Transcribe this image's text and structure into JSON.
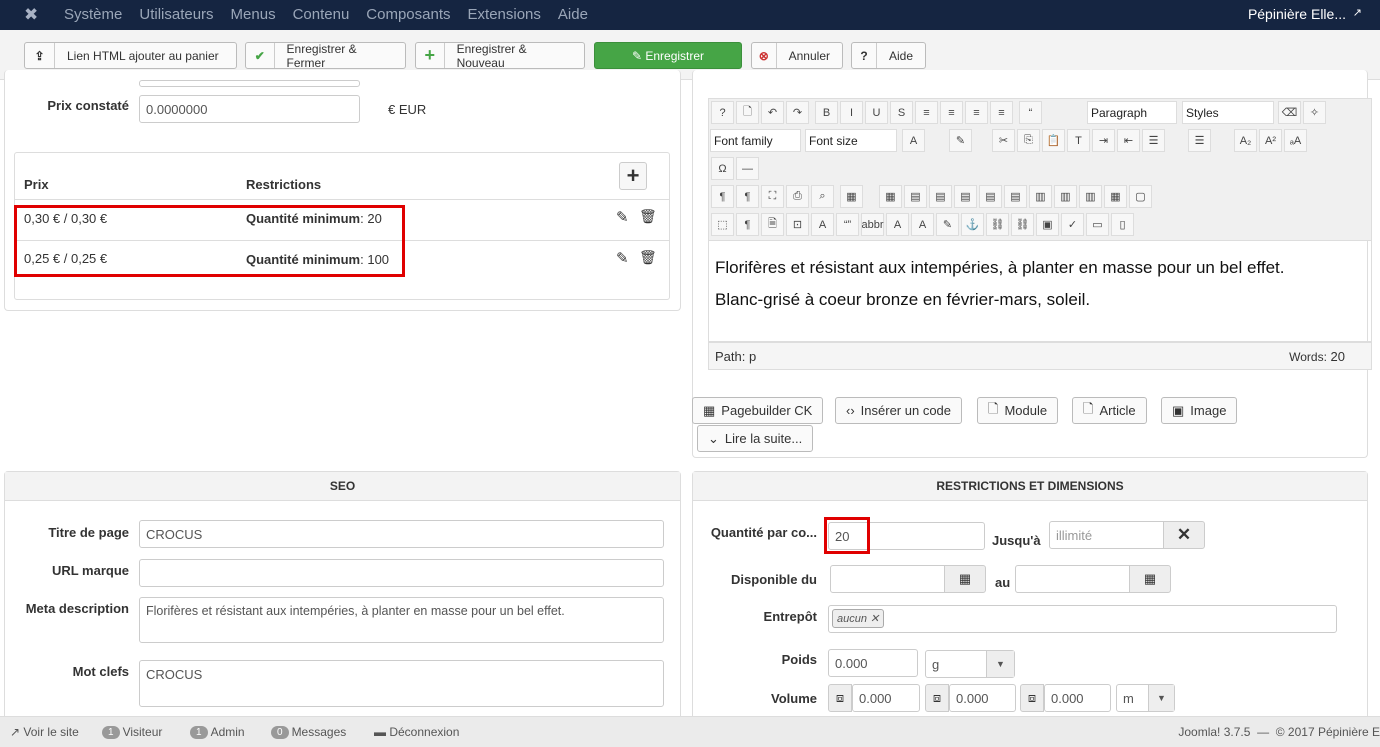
{
  "nav": {
    "items": [
      "Système",
      "Utilisateurs",
      "Menus",
      "Contenu",
      "Composants",
      "Extensions",
      "Aide"
    ],
    "site": "Pépinière Elle..."
  },
  "toolbar": {
    "buttons": [
      {
        "icon": "upload-icon",
        "label": "Lien HTML ajouter au panier"
      },
      {
        "icon": "check-icon",
        "label": "Enregistrer & Fermer"
      },
      {
        "icon": "plus-icon",
        "label": "Enregistrer & Nouveau"
      },
      {
        "icon": "edit-icon",
        "label": "Enregistrer"
      },
      {
        "icon": "cancel-icon",
        "label": "Annuler"
      },
      {
        "icon": "help-icon",
        "label": "Aide"
      }
    ],
    "accent": "#46a546"
  },
  "prices": {
    "prix_constate_label": "Prix constaté",
    "prix_constate_value": "0.0000000",
    "currency": "€ EUR",
    "headers": [
      "Prix",
      "Restrictions"
    ],
    "rows": [
      {
        "prix": "0,30 € / 0,30 €",
        "restriction_label": "Quantité minimum",
        "restriction_value": ": 20"
      },
      {
        "prix": "0,25 € / 0,25 €",
        "restriction_label": "Quantité minimum",
        "restriction_value": ": 100"
      }
    ]
  },
  "editor": {
    "format_select": "Paragraph",
    "styles_select": "Styles",
    "font_family": "Font family",
    "font_size": "Font size",
    "content": [
      "Florifères et résistant aux intempéries, à planter en masse pour un bel effet.",
      "Blanc-grisé à coeur bronze en février-mars, soleil."
    ],
    "path_label": "Path:",
    "path_value": "p",
    "words_label": "Words:",
    "words_value": "20",
    "buttons": [
      "Pagebuilder CK",
      "Insérer un code",
      "Module",
      "Article",
      "Image",
      "Lire la suite..."
    ]
  },
  "seo": {
    "title": "SEO",
    "fields": [
      {
        "label": "Titre de page",
        "value": "CROCUS"
      },
      {
        "label": "URL marque",
        "value": ""
      },
      {
        "label": "Meta description",
        "value": "Florifères et résistant aux intempéries, à planter en masse pour un bel effet."
      },
      {
        "label": "Mot clefs",
        "value": "CROCUS"
      }
    ]
  },
  "restrictions": {
    "title": "RESTRICTIONS ET DIMENSIONS",
    "qty_label": "Quantité par co...",
    "qty_value": "20",
    "until_label": "Jusqu'à",
    "until_placeholder": "illimité",
    "avail_label": "Disponible du",
    "au_label": "au",
    "warehouse_label": "Entrepôt",
    "warehouse_tag": "aucun",
    "weight_label": "Poids",
    "weight_value": "0.000",
    "weight_unit": "g",
    "volume_label": "Volume",
    "volume_values": [
      "0.000",
      "0.000",
      "0.000"
    ],
    "volume_unit": "m"
  },
  "status": {
    "view_site": "Voir le site",
    "visitors": "1",
    "visitors_label": "Visiteur",
    "admins": "1",
    "admins_label": "Admin",
    "messages": "0",
    "messages_label": "Messages",
    "logout": "Déconnexion",
    "version": "Joomla! 3.7.5  —  © 2017 Pépinière E"
  }
}
